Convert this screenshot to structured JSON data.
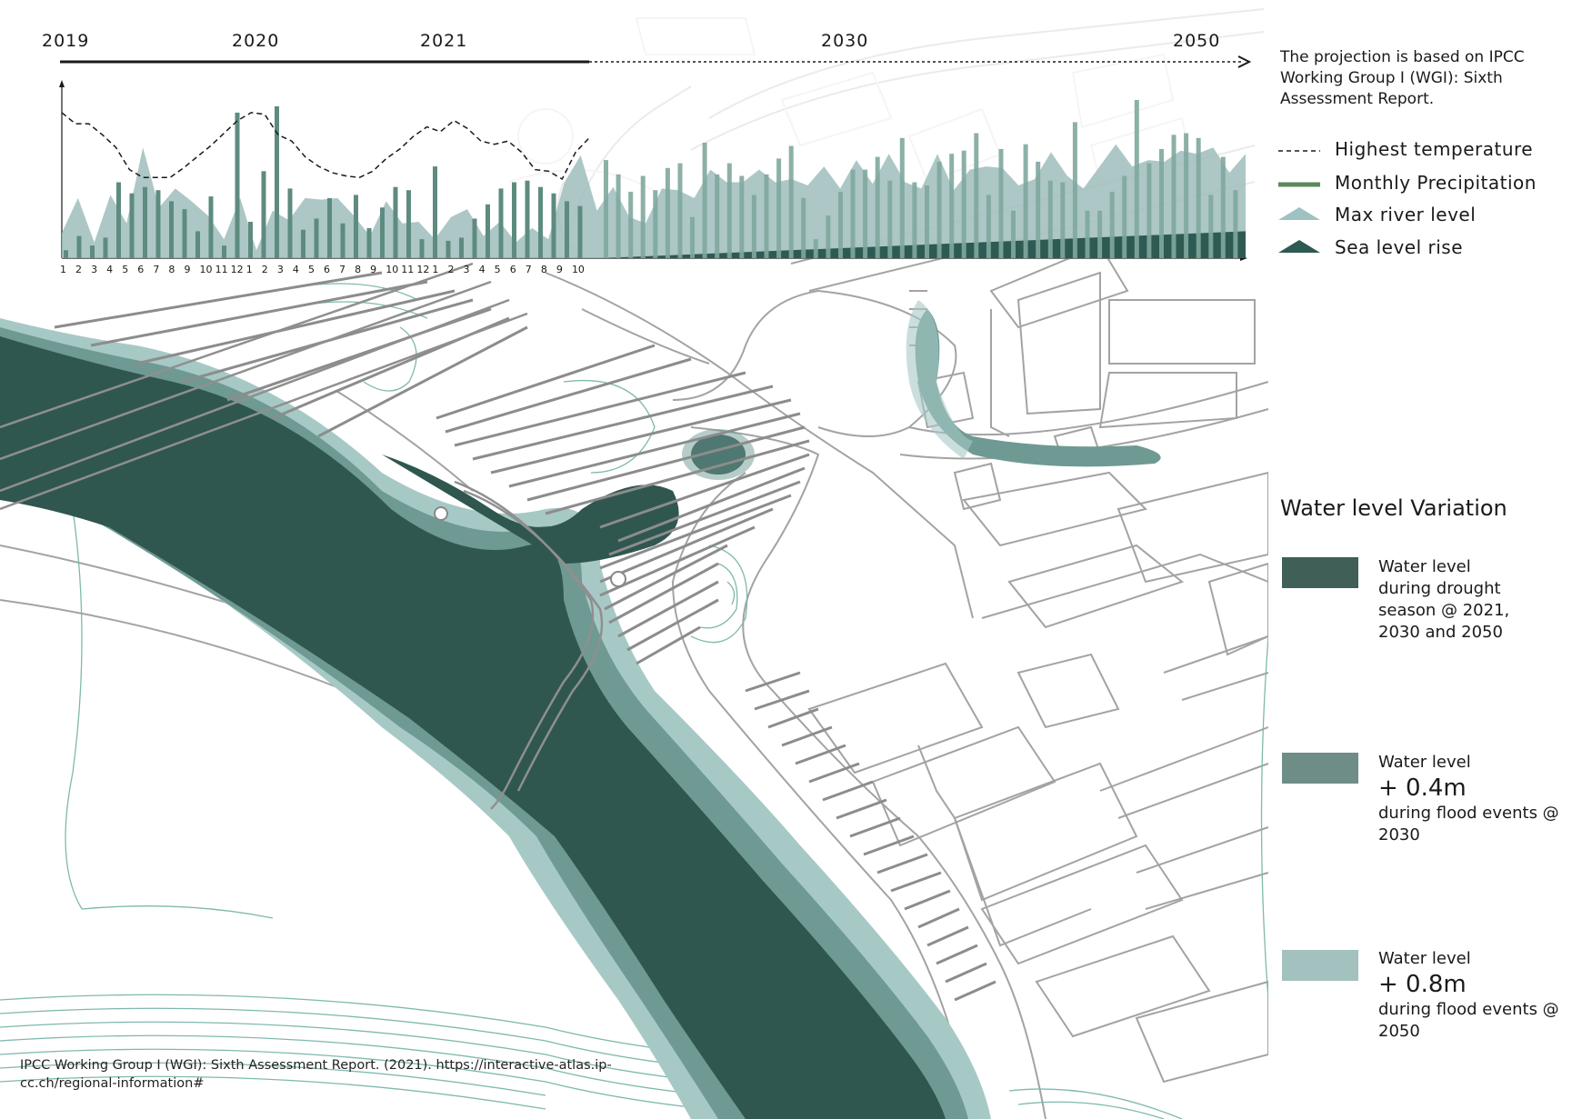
{
  "timeline": {
    "years": [
      "2019",
      "2020",
      "2021",
      "2030",
      "2050"
    ]
  },
  "chart_data": {
    "type": "bar",
    "x_ticks": [
      "1",
      "2",
      "3",
      "4",
      "5",
      "6",
      "7",
      "8",
      "9",
      "10",
      "11",
      "12",
      "1",
      "2",
      "3",
      "4",
      "5",
      "6",
      "7",
      "8",
      "9",
      "10",
      "11",
      "12",
      "1",
      "2",
      "3",
      "4",
      "5",
      "6",
      "7",
      "8",
      "9",
      "10"
    ],
    "series": [
      {
        "name": "Highest temperature",
        "type": "line",
        "style": "dashed",
        "values": [
          0.92,
          0.85,
          0.85,
          0.78,
          0.7,
          0.56,
          0.51,
          0.51,
          0.51,
          0.57,
          0.64,
          0.71,
          0.79,
          0.87,
          0.92,
          0.91,
          0.78,
          0.74,
          0.64,
          0.58,
          0.54,
          0.52,
          0.51,
          0.55,
          0.63,
          0.69,
          0.77,
          0.83,
          0.8,
          0.87,
          0.82,
          0.74,
          0.72,
          0.74,
          0.67,
          0.56,
          0.55,
          0.5,
          0.67,
          0.76
        ]
      },
      {
        "name": "Monthly Precipitation",
        "type": "bar",
        "values_observed": [
          0.05,
          0.14,
          0.08,
          0.13,
          0.48,
          0.41,
          0.45,
          0.43,
          0.36,
          0.31,
          0.17,
          0.39,
          0.08,
          0.92,
          0.23,
          0.55,
          0.96,
          0.44,
          0.18,
          0.25,
          0.38,
          0.22,
          0.4,
          0.19,
          0.32,
          0.45,
          0.43,
          0.12,
          0.58,
          0.11,
          0.13,
          0.25,
          0.34,
          0.44,
          0.48,
          0.49,
          0.45,
          0.41,
          0.36,
          0.33
        ],
        "values_projected": [
          0.62,
          0.53,
          0.42,
          0.52,
          0.43,
          0.57,
          0.6,
          0.26,
          0.73,
          0.53,
          0.6,
          0.52,
          0.4,
          0.53,
          0.63,
          0.71,
          0.38,
          0.12,
          0.27,
          0.42,
          0.56,
          0.56,
          0.64,
          0.49,
          0.76,
          0.48,
          0.46,
          0.61,
          0.66,
          0.68,
          0.79,
          0.4,
          0.69,
          0.3,
          0.72,
          0.61,
          0.49,
          0.48,
          0.86,
          0.3,
          0.3,
          0.42,
          0.52,
          1.0,
          0.6,
          0.69,
          0.78,
          0.79,
          0.76,
          0.4,
          0.64,
          0.43
        ]
      },
      {
        "name": "Max river level",
        "type": "area",
        "values": [
          0.16,
          0.38,
          0.1,
          0.4,
          0.22,
          0.7,
          0.32,
          0.44,
          0.36,
          0.27,
          0.12,
          0.38,
          0.05,
          0.3,
          0.24,
          0.38,
          0.37,
          0.38,
          0.27,
          0.14,
          0.36,
          0.22,
          0.23,
          0.12,
          0.26,
          0.31,
          0.14,
          0.23,
          0.1,
          0.19,
          0.12,
          0.48,
          0.65,
          0.3,
          0.45,
          0.26,
          0.22,
          0.44,
          0.43,
          0.38,
          0.56,
          0.48,
          0.48,
          0.56,
          0.48,
          0.5,
          0.46,
          0.58,
          0.44,
          0.62,
          0.47,
          0.66,
          0.48,
          0.44,
          0.66,
          0.43,
          0.56,
          0.58,
          0.57,
          0.46,
          0.5,
          0.67,
          0.52,
          0.44,
          0.58,
          0.72,
          0.58,
          0.62,
          0.61,
          0.68,
          0.66,
          0.7,
          0.54,
          0.66
        ]
      },
      {
        "name": "Sea level rise",
        "type": "area",
        "values": [
          0,
          0.17
        ]
      }
    ],
    "x_start": "2019",
    "x_end": "2050"
  },
  "legend": {
    "note": "The projection is based on IPCC Working Group I (WGI): Sixth Assessment Report.",
    "items": [
      {
        "label": "Highest temperature",
        "color": "#1a1a1a",
        "symbol": "dashed-line"
      },
      {
        "label": "Monthly Precipitation",
        "color": "#5b8a5a",
        "symbol": "solid-line"
      },
      {
        "label": "Max river level",
        "color": "#9fc1c1",
        "symbol": "mountain"
      },
      {
        "label": "Sea level rise",
        "color": "#2d5a52",
        "symbol": "mountain"
      }
    ]
  },
  "water_level_variation": {
    "title": "Water level Variation",
    "items": [
      {
        "color": "#3f5f57",
        "line1": "Water level",
        "big": "",
        "rest": "during drought season @ 2021, 2030 and 2050"
      },
      {
        "color": "#6e8d87",
        "line1": "Water level",
        "big": "+ 0.4m",
        "rest": "during  flood events @ 2030"
      },
      {
        "color": "#a2c1bf",
        "line1": "Water level",
        "big": "+ 0.8m",
        "rest": "during flood events @ 2050"
      }
    ]
  },
  "citation": "IPCC Working Group I (WGI): Sixth Assessment Report. (2021). https://interactive-atlas.ip-cc.ch/regional-information#",
  "colors": {
    "drought": "#2f574f",
    "flood_04": "#6e9a93",
    "flood_08": "#a7c9c6",
    "road": "#9a9a9a",
    "contour": "#6fb0a3",
    "chart_bar": "#5e8b80",
    "chart_area": "#9dbdbc"
  }
}
